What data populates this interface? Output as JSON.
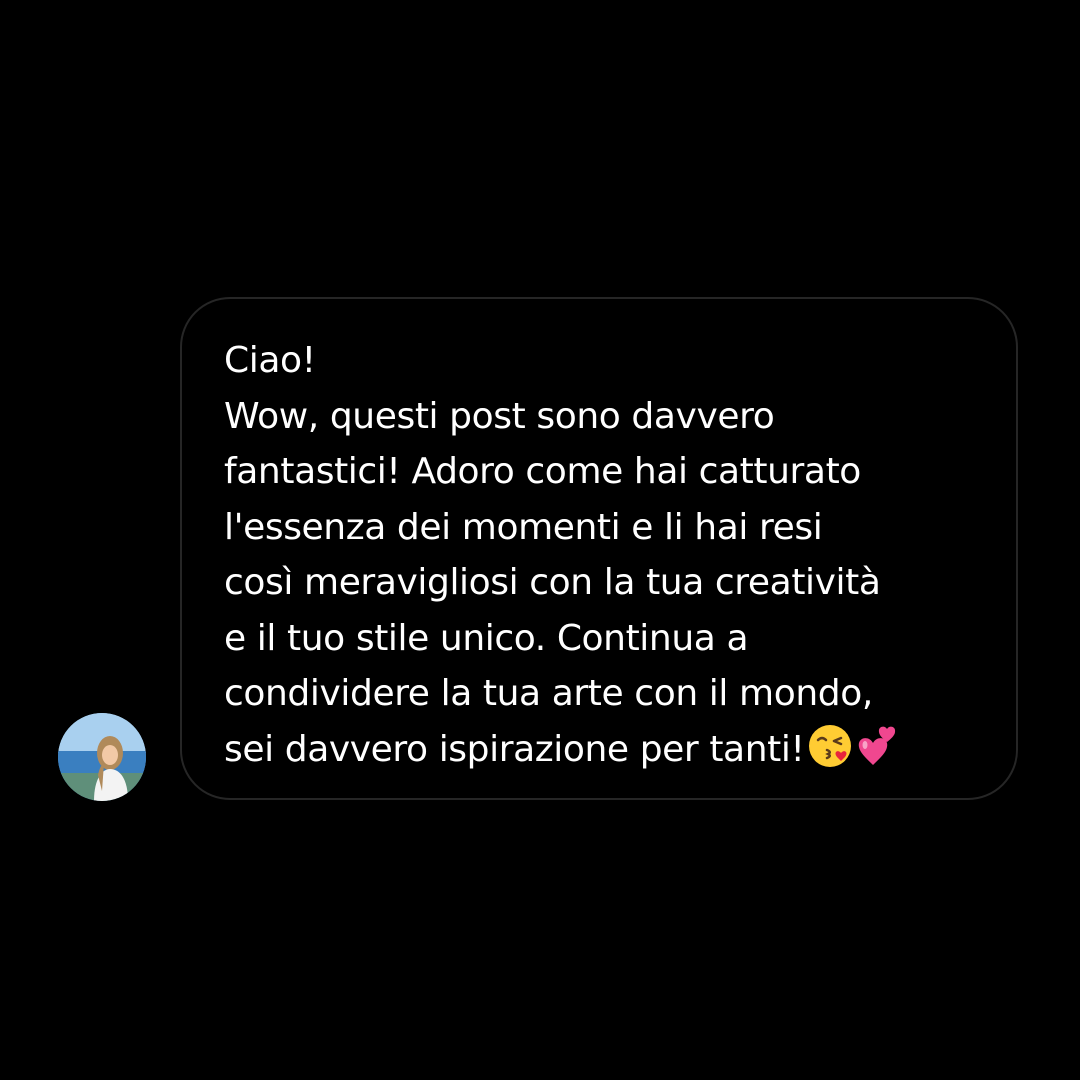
{
  "chat": {
    "message": {
      "lines": [
        "Ciao!",
        "Wow, questi post sono davvero",
        "fantastici! Adoro come hai catturato",
        "l'essenza dei momenti e li hai resi",
        "così meravigliosi con la tua creatività",
        "e il tuo stile unico. Continua a",
        "condividere la tua arte con il mondo,",
        "sei davvero ispirazione per tanti!"
      ],
      "emojis": [
        "kissing-face-emoji",
        "two-hearts-emoji"
      ]
    },
    "avatar": "sender-profile-photo"
  },
  "colors": {
    "background": "#000000",
    "bubble_border": "#262626",
    "text": "#ffffff",
    "heart": "#f0478f",
    "emoji_face": "#ffcc33"
  }
}
